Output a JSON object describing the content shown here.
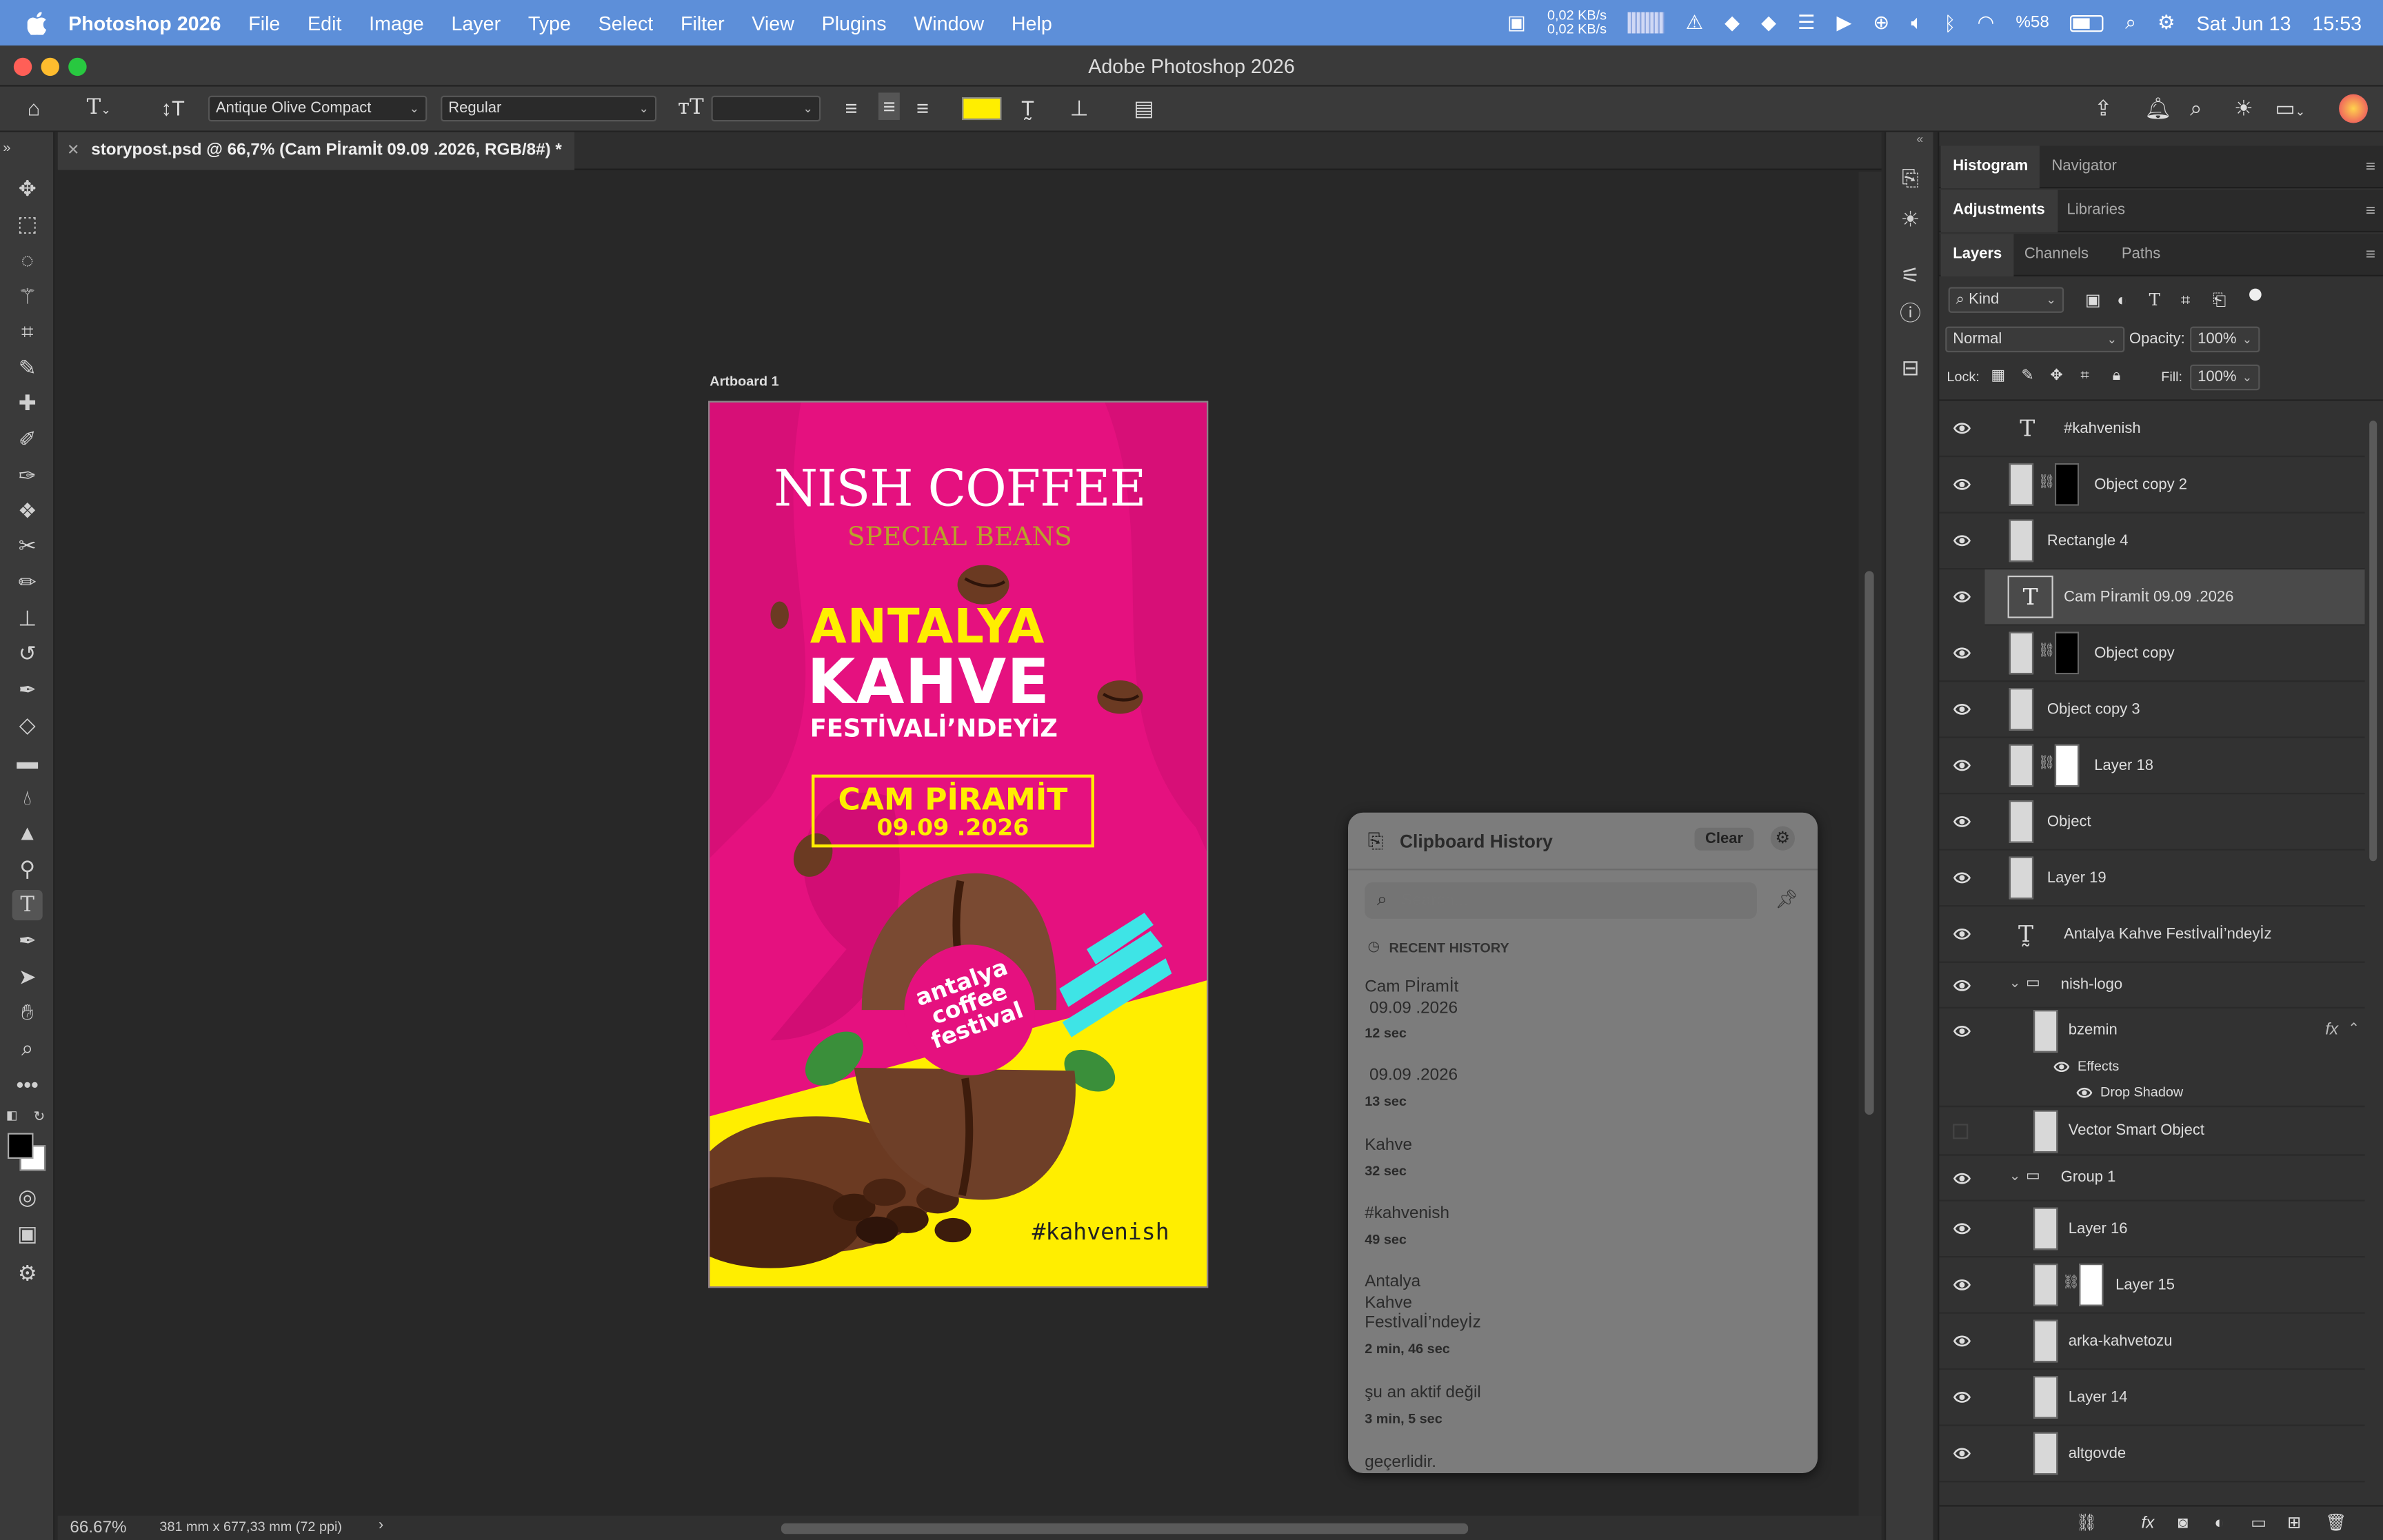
{
  "menubar": {
    "app": "Photoshop 2026",
    "items": [
      "File",
      "Edit",
      "Image",
      "Layer",
      "Type",
      "Select",
      "Filter",
      "View",
      "Plugins",
      "Window",
      "Help"
    ],
    "net_up": "0,02 KB/s",
    "net_down": "0,02 KB/s",
    "battery": "%58",
    "date": "Sat Jun 13",
    "time": "15:53"
  },
  "window": {
    "title": "Adobe Photoshop 2026"
  },
  "options": {
    "font_family": "Antique Olive Compact",
    "font_style": "Regular",
    "font_size": "",
    "text_color": "#ffee00"
  },
  "document": {
    "tab": "storypost.psd @ 66,7% (Cam Pİramİt  09.09 .2026, RGB/8#) *",
    "artboard_label": "Artboard 1",
    "zoom": "66.67%",
    "size": "381 mm x 677,33 mm (72 ppi)"
  },
  "artwork": {
    "brand": "NISH COFFEE",
    "tagline": "SPECIAL BEANS",
    "line1": "ANTALYA",
    "line2": "KAHVE",
    "line3": "FESTİVALİ’NDEYİZ",
    "venue": "CAM PİRAMİT",
    "date": "09.09 .2026",
    "badge1": "antalya",
    "badge2": "coffee",
    "badge3": "festival",
    "hashtag": "#kahvenish",
    "colors": {
      "magenta": "#e5117f",
      "yellow": "#ffee00",
      "cyan": "#3ee4e6"
    }
  },
  "panels": {
    "tab_histogram": "Histogram",
    "tab_navigator": "Navigator",
    "tab_adjustments": "Adjustments",
    "tab_libraries": "Libraries",
    "tab_layers": "Layers",
    "tab_channels": "Channels",
    "tab_paths": "Paths",
    "kind": "Kind",
    "blend": "Normal",
    "opacity_label": "Opacity:",
    "opacity": "100%",
    "lock_label": "Lock:",
    "fill_label": "Fill:",
    "fill": "100%"
  },
  "layers": {
    "l1": "#kahvenish",
    "l2": "Object copy 2",
    "l3": "Rectangle 4",
    "l4": "Cam Pİramİt  09.09 .2026",
    "l5": "Object copy",
    "l6": "Object copy 3",
    "l7": "Layer 18",
    "l8": "Object",
    "l9": "Layer 19",
    "l10": "Antalya  Kahve  Festİvalİ’ndeyİz",
    "l11": "nish-logo",
    "l12": "bzemin",
    "l12fx": "fx",
    "l13": "Effects",
    "l14": "Drop Shadow",
    "l15": "Vector Smart Object",
    "l16": "Group 1",
    "l17": "Layer 16",
    "l18": "Layer 15",
    "l19": "arka-kahvetozu",
    "l20": "Layer 14",
    "l21": "altgovde"
  },
  "clipboard": {
    "title": "Clipboard History",
    "clear": "Clear",
    "search_placeholder": "Search...",
    "section": "RECENT HISTORY",
    "items": [
      {
        "text": "Cam Pİramİt\n 09.09 .2026",
        "time": "12 sec"
      },
      {
        "text": " 09.09 .2026",
        "time": "13 sec"
      },
      {
        "text": "Kahve",
        "time": "32 sec"
      },
      {
        "text": "#kahvenish",
        "time": "49 sec"
      },
      {
        "text": "Antalya\nKahve\nFestİvalİ’ndeyİz",
        "time": "2 min, 46 sec"
      },
      {
        "text": "şu an aktif değil",
        "time": "3 min, 5 sec"
      },
      {
        "text": "geçerlidir.",
        "time": ""
      }
    ]
  }
}
